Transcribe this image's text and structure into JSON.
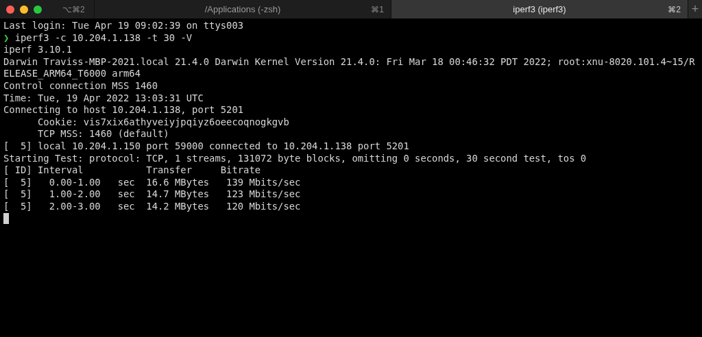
{
  "window": {
    "shortcut": "⌥⌘2"
  },
  "tabs": [
    {
      "label": "/Applications (-zsh)",
      "shortcut": "⌘1",
      "selected": false
    },
    {
      "label": "iperf3 (iperf3)",
      "shortcut": "⌘2",
      "selected": true
    }
  ],
  "new_tab": "+",
  "terminal": {
    "lines": [
      {
        "kind": "output",
        "text": "Last login: Tue Apr 19 09:02:39 on ttys003"
      },
      {
        "kind": "prompt",
        "prompt": "❯",
        "text": "iperf3 -c 10.204.1.138 -t 30 -V"
      },
      {
        "kind": "output",
        "text": "iperf 3.10.1"
      },
      {
        "kind": "output",
        "text": "Darwin Traviss-MBP-2021.local 21.4.0 Darwin Kernel Version 21.4.0: Fri Mar 18 00:46:32 PDT 2022; root:xnu-8020.101.4~15/R"
      },
      {
        "kind": "output",
        "text": "ELEASE_ARM64_T6000 arm64"
      },
      {
        "kind": "output",
        "text": "Control connection MSS 1460"
      },
      {
        "kind": "output",
        "text": "Time: Tue, 19 Apr 2022 13:03:31 UTC"
      },
      {
        "kind": "output",
        "text": "Connecting to host 10.204.1.138, port 5201"
      },
      {
        "kind": "output",
        "text": "      Cookie: vis7xix6athyveiyjpqiyz6oeecoqnogkgvb"
      },
      {
        "kind": "output",
        "text": "      TCP MSS: 1460 (default)"
      },
      {
        "kind": "output",
        "text": "[  5] local 10.204.1.150 port 59000 connected to 10.204.1.138 port 5201"
      },
      {
        "kind": "output",
        "text": "Starting Test: protocol: TCP, 1 streams, 131072 byte blocks, omitting 0 seconds, 30 second test, tos 0"
      },
      {
        "kind": "output",
        "text": "[ ID] Interval           Transfer     Bitrate"
      },
      {
        "kind": "output",
        "text": "[  5]   0.00-1.00   sec  16.6 MBytes   139 Mbits/sec"
      },
      {
        "kind": "output",
        "text": "[  5]   1.00-2.00   sec  14.7 MBytes   123 Mbits/sec"
      },
      {
        "kind": "output",
        "text": "[  5]   2.00-3.00   sec  14.2 MBytes   120 Mbits/sec"
      },
      {
        "kind": "cursor"
      }
    ]
  }
}
